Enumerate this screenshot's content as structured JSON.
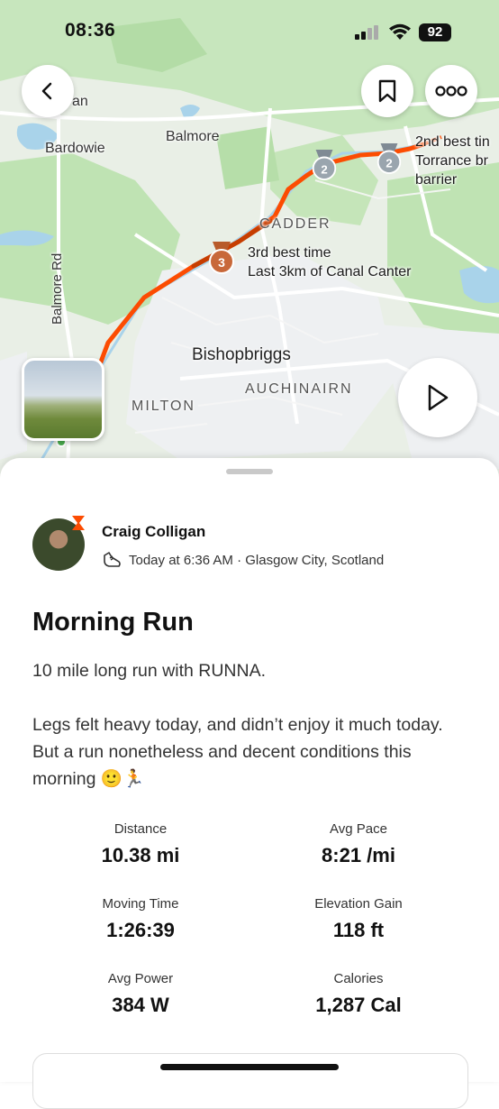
{
  "status_bar": {
    "time": "08:36",
    "battery": "92"
  },
  "map": {
    "labels": {
      "an": "an",
      "bardowie": "Bardowie",
      "balmore": "Balmore",
      "cadder": "CADDER",
      "balmore_rd": "Balmore Rd",
      "bishopbriggs": "Bishopbriggs",
      "auchinairn": "AUCHINAIRN",
      "milton": "MILTON"
    },
    "segments": [
      {
        "medal": "3",
        "line1": "3rd best time",
        "line2": "Last 3km of Canal Canter"
      },
      {
        "medal": "2",
        "line1": "2nd best tin",
        "line2": "Torrance br",
        "line3": "barrier"
      }
    ],
    "colors": {
      "route": "#fc4c02",
      "water": "#a9d3ea",
      "park": "#bfe4b4",
      "land": "#e8eee4"
    }
  },
  "activity": {
    "athlete": "Craig Colligan",
    "meta": "Today at 6:36 AM · Glasgow City, Scotland",
    "title": "Morning Run",
    "description": [
      "10 mile long run with RUNNA.",
      "Legs felt heavy today, and didn’t enjoy it much today. But a run nonetheless and decent conditions this morning 🙂🏃"
    ]
  },
  "stats": [
    {
      "label": "Distance",
      "value": "10.38 mi"
    },
    {
      "label": "Avg Pace",
      "value": "8:21 /mi"
    },
    {
      "label": "Moving Time",
      "value": "1:26:39"
    },
    {
      "label": "Elevation Gain",
      "value": "118 ft"
    },
    {
      "label": "Avg Power",
      "value": "384 W"
    },
    {
      "label": "Calories",
      "value": "1,287 Cal"
    }
  ]
}
